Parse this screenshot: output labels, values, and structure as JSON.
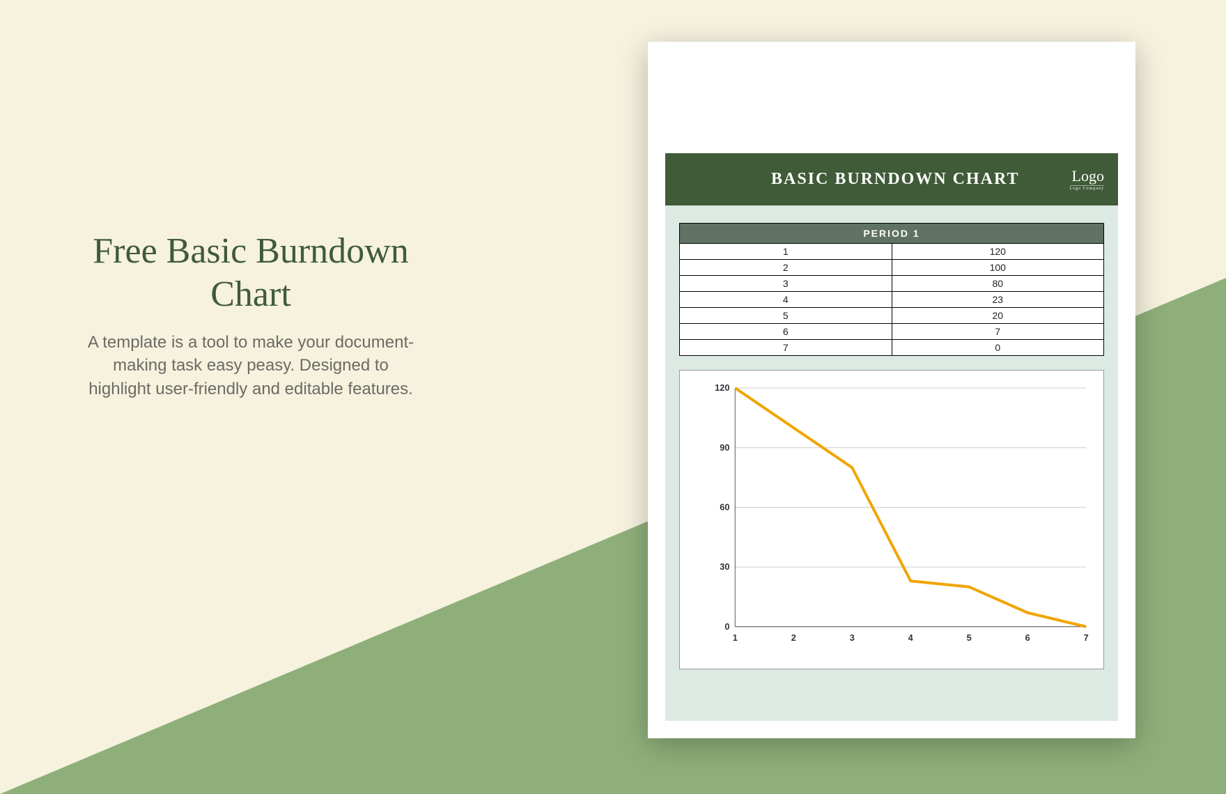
{
  "promo": {
    "title": "Free Basic Burndown Chart",
    "description": "A template is a tool to make your document-making task easy peasy. Designed to highlight user-friendly and editable features."
  },
  "document": {
    "header_title": "BASIC BURNDOWN CHART",
    "logo_text": "Logo",
    "logo_subtext": "Logo Company",
    "table_header": "PERIOD 1",
    "rows": [
      {
        "period": "1",
        "value": "120"
      },
      {
        "period": "2",
        "value": "100"
      },
      {
        "period": "3",
        "value": "80"
      },
      {
        "period": "4",
        "value": "23"
      },
      {
        "period": "5",
        "value": "20"
      },
      {
        "period": "6",
        "value": "7"
      },
      {
        "period": "7",
        "value": "0"
      }
    ]
  },
  "chart_data": {
    "type": "line",
    "categories": [
      "1",
      "2",
      "3",
      "4",
      "5",
      "6",
      "7"
    ],
    "values": [
      120,
      100,
      80,
      23,
      20,
      7,
      0
    ],
    "title": "",
    "xlabel": "",
    "ylabel": "",
    "ylim": [
      0,
      120
    ],
    "yticks": [
      0,
      30,
      60,
      90,
      120
    ],
    "line_color": "#f0a500"
  }
}
